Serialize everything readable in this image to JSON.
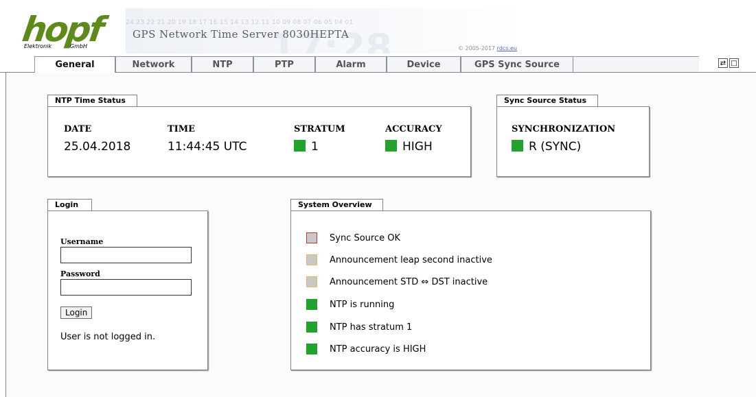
{
  "header": {
    "logo_word": "hopf",
    "logo_sub_left": "Elektronik",
    "logo_sub_right": "GmbH",
    "banner_digits": "24 23 22 21 20 19 18 17 16 15 14 13 12 11 10 09 08 07 06 05 04 01",
    "title": "GPS Network Time Server 8030HEPTA",
    "copyright_prefix": "© 2005-2017",
    "copyright_link": "rdcs.eu"
  },
  "tabs": [
    {
      "label": "General"
    },
    {
      "label": "Network"
    },
    {
      "label": "NTP"
    },
    {
      "label": "PTP"
    },
    {
      "label": "Alarm"
    },
    {
      "label": "Device"
    },
    {
      "label": "GPS Sync Source"
    }
  ],
  "ntp_status": {
    "title": "NTP Time Status",
    "date_label": "DATE",
    "date_value": "25.04.2018",
    "time_label": "TIME",
    "time_value": "11:44:45 UTC",
    "stratum_label": "STRATUM",
    "stratum_value": "1",
    "accuracy_label": "ACCURACY",
    "accuracy_value": "HIGH"
  },
  "sync_status": {
    "title": "Sync Source Status",
    "sync_label": "SYNCHRONIZATION",
    "sync_value": "R (SYNC)"
  },
  "login": {
    "title": "Login",
    "username_label": "Username",
    "password_label": "Password",
    "button": "Login",
    "status": "User is not logged in."
  },
  "overview": {
    "title": "System Overview",
    "items": [
      {
        "text": "Sync Source OK",
        "state": "error"
      },
      {
        "text": "Announcement leap second inactive",
        "state": "inactive"
      },
      {
        "text": "Announcement STD ⇔ DST inactive",
        "state": "inactive"
      },
      {
        "text": "NTP is running",
        "state": "ok"
      },
      {
        "text": "NTP has stratum 1",
        "state": "ok"
      },
      {
        "text": "NTP accuracy is HIGH",
        "state": "ok"
      }
    ]
  },
  "colors": {
    "ok": "#22a32e",
    "inactive_fill": "#c8c8c8",
    "inactive_border": "#e6b95a",
    "error_border": "#c8302c",
    "logo": "#5e8a1c"
  }
}
